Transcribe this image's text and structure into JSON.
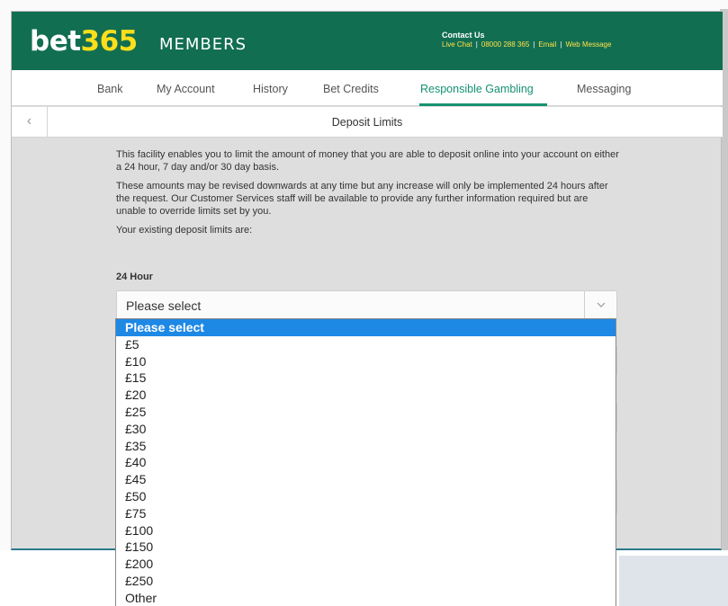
{
  "header": {
    "logo_prefix": "bet",
    "logo_number": "365",
    "logo_suffix": "MEMBERS",
    "contact_title": "Contact Us",
    "contact_links": [
      "Live Chat",
      "08000 288 365",
      "Email",
      "Web Message"
    ],
    "separator": "|"
  },
  "nav": {
    "items": [
      "Bank",
      "My Account",
      "History",
      "Bet Credits",
      "Responsible Gambling",
      "Messaging"
    ],
    "active": "Responsible Gambling"
  },
  "subbar": {
    "back_glyph": "‹",
    "title": "Deposit Limits"
  },
  "content": {
    "para1": "This facility enables you to limit the amount of money that you are able to deposit online into your account on either a 24 hour, 7 day and/or 30 day basis.",
    "para2": "These amounts may be revised downwards at any time but any increase will only be implemented 24 hours after the request. Our Customer Services staff will be available to provide any further information required but are unable to override limits set by you.",
    "para3": "Your existing deposit limits are:",
    "label_24h": "24 Hour"
  },
  "select_24h": {
    "value": "Please select",
    "options": [
      "Please select",
      "£5",
      "£10",
      "£15",
      "£20",
      "£25",
      "£30",
      "£35",
      "£40",
      "£45",
      "£50",
      "£75",
      "£100",
      "£150",
      "£200",
      "£250",
      "Other"
    ],
    "highlighted": "Please select"
  },
  "colors": {
    "brand_green": "#126e51",
    "brand_yellow": "#ffdf1b",
    "active_tab": "#159271",
    "selection_blue": "#1e88e5"
  }
}
